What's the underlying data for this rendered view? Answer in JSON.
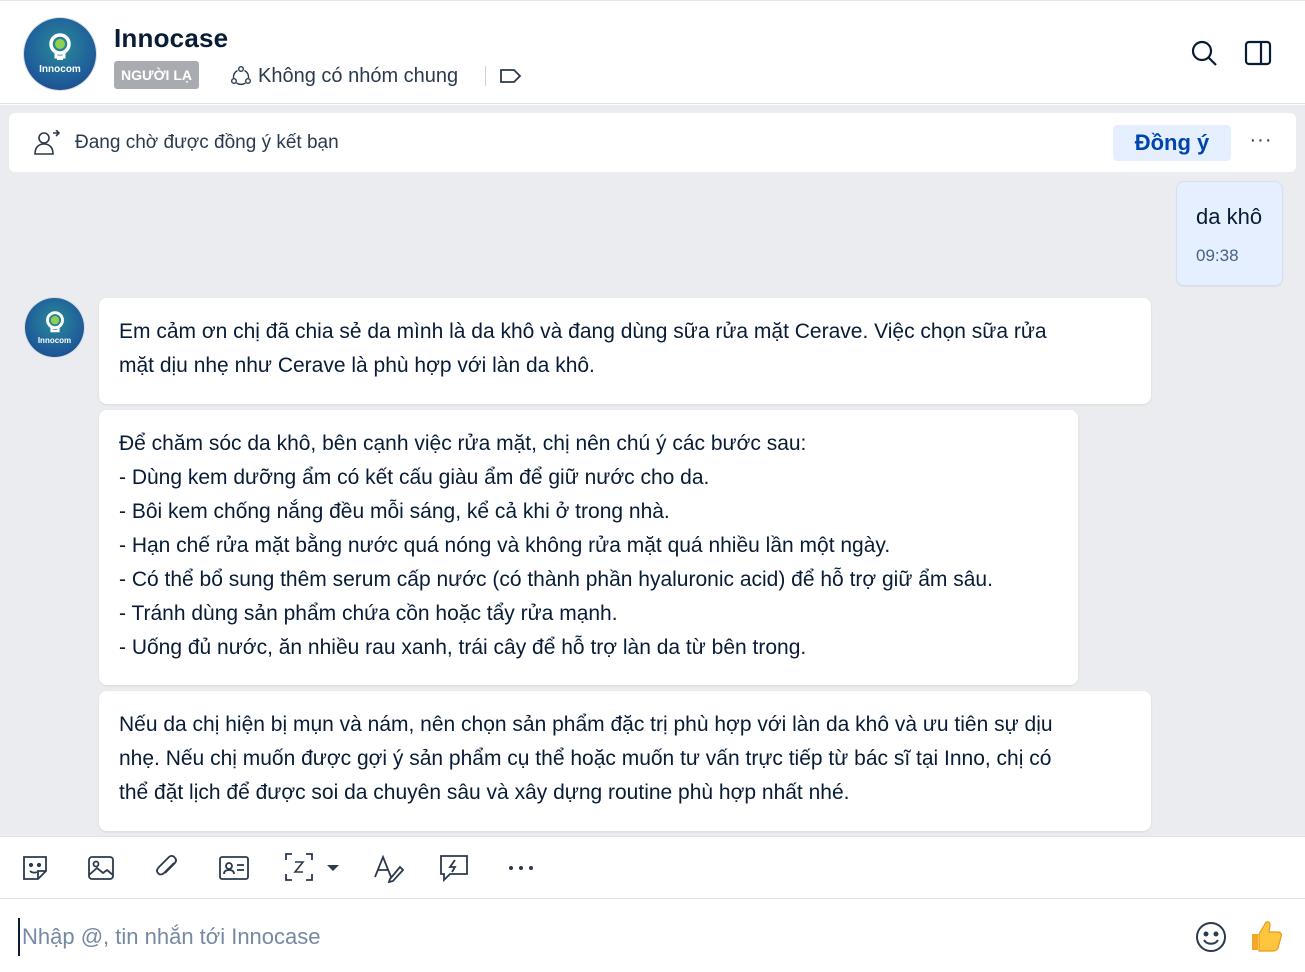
{
  "header": {
    "name": "Innocase",
    "badge": "NGƯỜI LẠ",
    "group_text": "Không có nhóm chung",
    "avatar_brand": "Innocom"
  },
  "friend_request": {
    "text": "Đang chờ được đồng ý kết bạn",
    "accept_label": "Đồng ý",
    "more_label": "···"
  },
  "messages": {
    "me": {
      "text": "da khô",
      "time": "09:38"
    },
    "bot": [
      "Em cảm ơn chị đã chia sẻ da mình là da khô và đang dùng sữa rửa mặt Cerave. Việc chọn sữa rửa\nmặt dịu nhẹ như Cerave là phù hợp với làn da khô.",
      "Để chăm sóc da khô, bên cạnh việc rửa mặt, chị nên chú ý các bước sau:\n- Dùng kem dưỡng ẩm có kết cấu giàu ẩm để giữ nước cho da.\n- Bôi kem chống nắng đều mỗi sáng, kể cả khi ở trong nhà.\n- Hạn chế rửa mặt bằng nước quá nóng và không rửa mặt quá nhiều lần một ngày.\n- Có thể bổ sung thêm serum cấp nước (có thành phần hyaluronic acid) để hỗ trợ giữ ẩm sâu.\n- Tránh dùng sản phẩm chứa cồn hoặc tẩy rửa mạnh.\n- Uống đủ nước, ăn nhiều rau xanh, trái cây để hỗ trợ làn da từ bên trong.",
      "Nếu da chị hiện bị mụn và nám, nên chọn sản phẩm đặc trị phù hợp với làn da khô và ưu tiên sự dịu\nnhẹ. Nếu chị muốn được gợi ý sản phẩm cụ thể hoặc muốn tư vấn trực tiếp từ bác sĩ tại Inno, chị có\nthể đặt lịch để được soi da chuyên sâu và xây dựng routine phù hợp nhất nhé."
    ]
  },
  "toolbar": {
    "icons": [
      "sticker-icon",
      "image-icon",
      "attachment-icon",
      "contact-card-icon",
      "screenshot-icon",
      "text-format-icon",
      "quick-message-icon",
      "more-icon"
    ],
    "more_label": "···"
  },
  "composer": {
    "placeholder": "Nhập @, tin nhắn tới Innocase"
  },
  "colors": {
    "accent": "#0045ad",
    "accent_bg": "#e5efff",
    "chat_bg": "#ebecf0"
  }
}
